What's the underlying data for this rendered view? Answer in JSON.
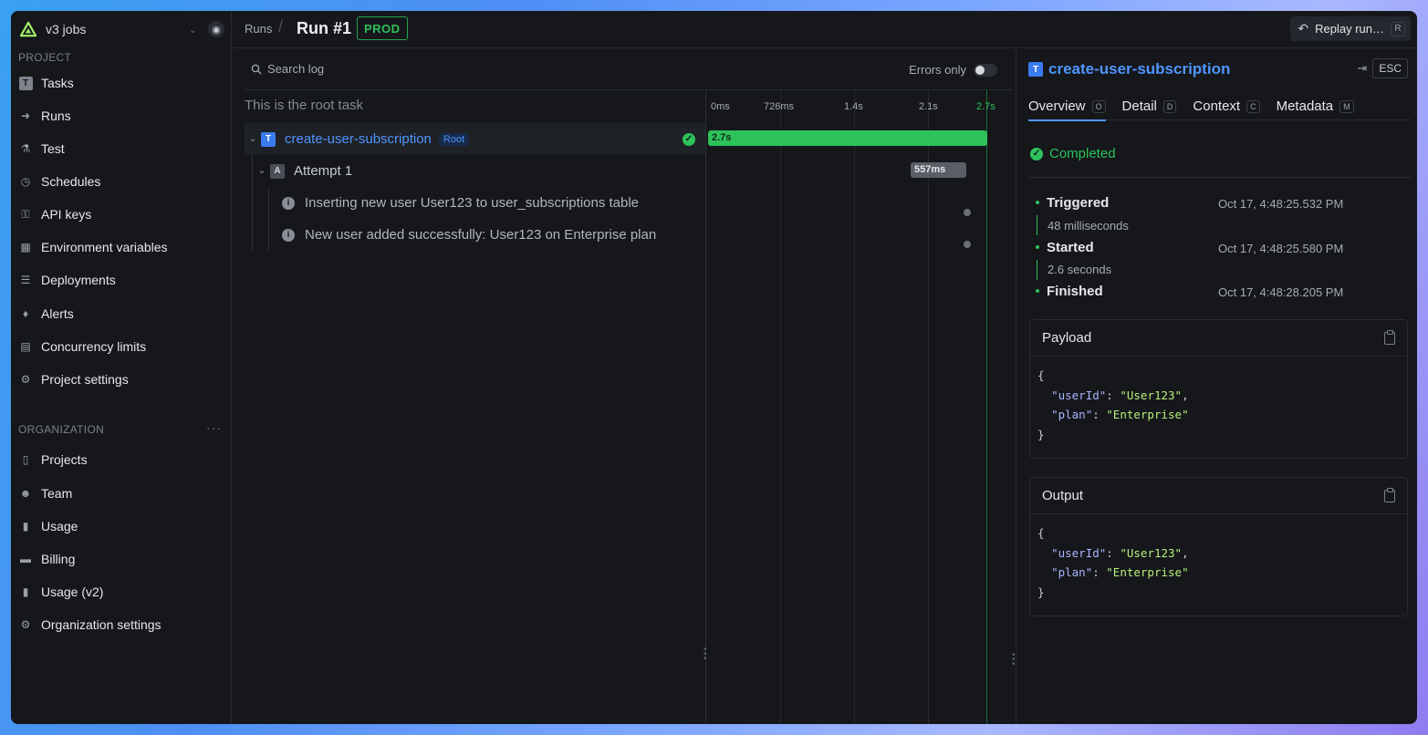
{
  "sidebar": {
    "workspace": "v3 jobs",
    "project_label": "PROJECT",
    "project_items": [
      {
        "label": "Tasks",
        "icon": "task-icon"
      },
      {
        "label": "Runs",
        "icon": "runs-icon"
      },
      {
        "label": "Test",
        "icon": "beaker-icon"
      },
      {
        "label": "Schedules",
        "icon": "clock-icon"
      },
      {
        "label": "API keys",
        "icon": "key-icon"
      },
      {
        "label": "Environment variables",
        "icon": "env-icon"
      },
      {
        "label": "Deployments",
        "icon": "server-icon"
      },
      {
        "label": "Alerts",
        "icon": "bell-icon"
      },
      {
        "label": "Concurrency limits",
        "icon": "stack-icon"
      },
      {
        "label": "Project settings",
        "icon": "gear-icon"
      }
    ],
    "org_label": "ORGANIZATION",
    "org_items": [
      {
        "label": "Projects",
        "icon": "folder-icon"
      },
      {
        "label": "Team",
        "icon": "team-icon"
      },
      {
        "label": "Usage",
        "icon": "chart-icon"
      },
      {
        "label": "Billing",
        "icon": "card-icon"
      },
      {
        "label": "Usage (v2)",
        "icon": "chart-icon"
      },
      {
        "label": "Organization settings",
        "icon": "gear-icon"
      }
    ]
  },
  "header": {
    "crumb_runs": "Runs",
    "run_title": "Run #1",
    "env_badge": "PROD",
    "replay_label": "Replay run…",
    "replay_key": "R"
  },
  "log": {
    "search_placeholder": "Search log",
    "errors_only": "Errors only",
    "root_heading": "This is the root task",
    "root_task": "create-user-subscription",
    "root_badge": "Root",
    "attempt": "Attempt 1",
    "events": [
      "Inserting new user User123 to user_subscriptions table",
      "New user added successfully: User123 on Enterprise plan"
    ]
  },
  "timeline": {
    "ticks": [
      "0ms",
      "726ms",
      "1.4s",
      "2.1s",
      "2.7s"
    ],
    "main_bar": "2.7s",
    "attempt_bar": "557ms"
  },
  "detail": {
    "title": "create-user-subscription",
    "esc": "ESC",
    "tabs": [
      {
        "label": "Overview",
        "key": "O"
      },
      {
        "label": "Detail",
        "key": "D"
      },
      {
        "label": "Context",
        "key": "C"
      },
      {
        "label": "Metadata",
        "key": "M"
      }
    ],
    "status": "Completed",
    "triggered": "Triggered",
    "triggered_at": "Oct 17, 4:48:25.532 PM",
    "wait": "48 milliseconds",
    "started": "Started",
    "started_at": "Oct 17, 4:48:25.580 PM",
    "duration": "2.6 seconds",
    "finished": "Finished",
    "finished_at": "Oct 17, 4:48:28.205 PM",
    "payload_title": "Payload",
    "output_title": "Output",
    "json": {
      "open": "{",
      "close": "}",
      "k1": "\"userId\"",
      "v1": "\"User123\"",
      "k2": "\"plan\"",
      "v2": "\"Enterprise\""
    }
  }
}
